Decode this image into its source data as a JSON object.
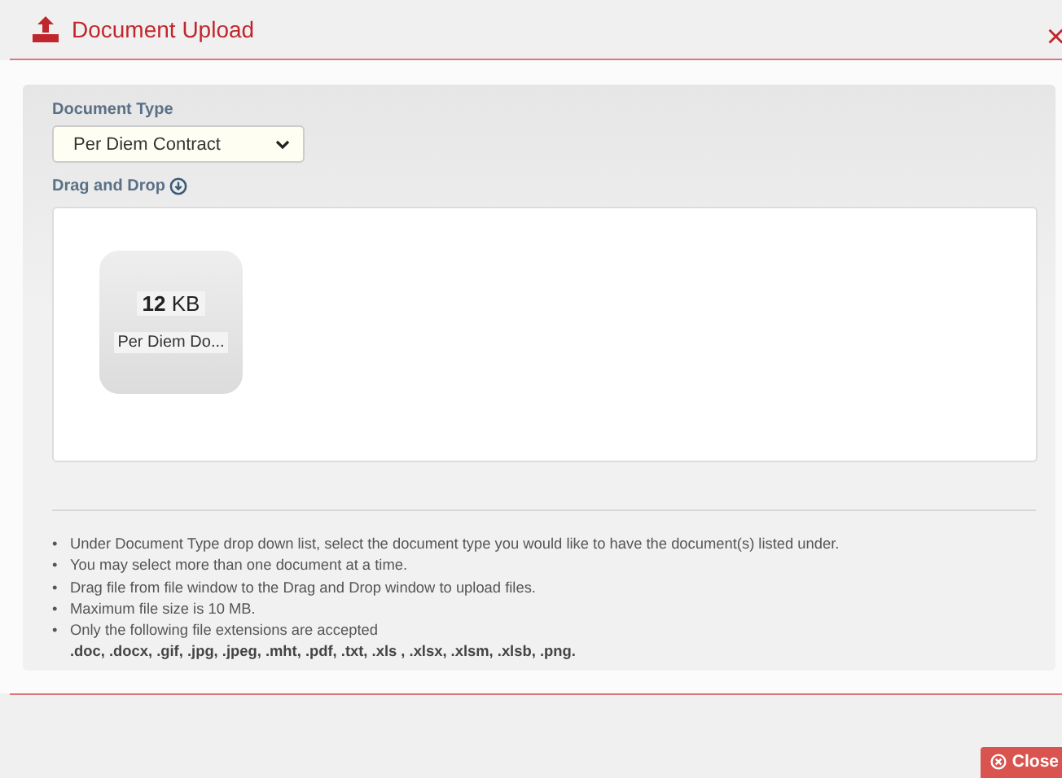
{
  "dialog": {
    "title": "Document Upload",
    "close_icon": "×"
  },
  "document_type": {
    "label": "Document Type",
    "value": "Per Diem Contract"
  },
  "drag_drop": {
    "label": "Drag and Drop",
    "files": [
      {
        "size": "**12** KB",
        "name": "Per Diem Do..."
      }
    ]
  },
  "instructions": [
    {
      "bullet": "•",
      "text": "Under Document Type drop down list, select the document type you would like to have the document(s) listed under."
    },
    {
      "bullet": "•",
      "text": "You may select more than one document at a time."
    },
    {
      "bullet": "•",
      "text": "Drag file from file window to the Drag and Drop window to upload files."
    },
    {
      "bullet": "•",
      "text": "Maximum file size is 10 MB."
    },
    {
      "bullet": "•",
      "text": "Only the following file extensions are accepted",
      "extensions": ".doc, .docx, .gif, .jpg, .jpeg, .mht, .pdf, .txt, .xls , .xlsx, .xlsm, .xlsb, .png."
    }
  ],
  "footer": {
    "close_button": "Close"
  }
}
